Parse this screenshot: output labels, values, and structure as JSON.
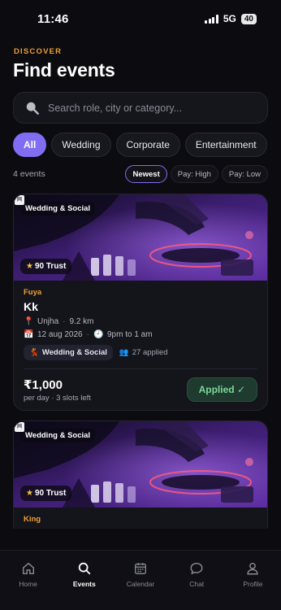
{
  "status_bar": {
    "time": "11:46",
    "network": "5G",
    "battery": "40"
  },
  "header": {
    "eyebrow": "DISCOVER",
    "title": "Find events"
  },
  "search": {
    "placeholder": "Search role, city or category..."
  },
  "filters": {
    "chips": [
      {
        "label": "All",
        "active": true
      },
      {
        "label": "Wedding",
        "active": false
      },
      {
        "label": "Corporate",
        "active": false
      },
      {
        "label": "Entertainment",
        "active": false
      }
    ]
  },
  "results": {
    "count_label": "4 events",
    "sort_options": [
      {
        "label": "Newest",
        "active": true
      },
      {
        "label": "Pay: High",
        "active": false
      },
      {
        "label": "Pay: Low",
        "active": false
      }
    ]
  },
  "events": [
    {
      "category": "Wedding & Social",
      "trust": "90 Trust",
      "company": "Fuya",
      "name": "Kk",
      "location": "Unjha",
      "distance": "9.2 km",
      "date": "12 aug 2026",
      "time": "9pm to 1 am",
      "tag": "Wedding & Social",
      "applied_count": "27 applied",
      "price": "₹1,000",
      "price_sub": "per day · 3 slots left",
      "action_label": "Applied ✓"
    },
    {
      "category": "Wedding & Social",
      "trust": "90 Trust",
      "company": "King"
    }
  ],
  "tab_bar": {
    "tabs": [
      {
        "label": "Home",
        "icon": "home-icon",
        "active": false
      },
      {
        "label": "Events",
        "icon": "search-icon",
        "active": true
      },
      {
        "label": "Calendar",
        "icon": "calendar-icon",
        "active": false
      },
      {
        "label": "Chat",
        "icon": "chat-icon",
        "active": false
      },
      {
        "label": "Profile",
        "icon": "profile-icon",
        "active": false
      }
    ]
  },
  "colors": {
    "accent": "#7f6ef2",
    "eyebrow": "#f0a136",
    "applied": "#7ad99a",
    "background": "#0b0b10"
  }
}
